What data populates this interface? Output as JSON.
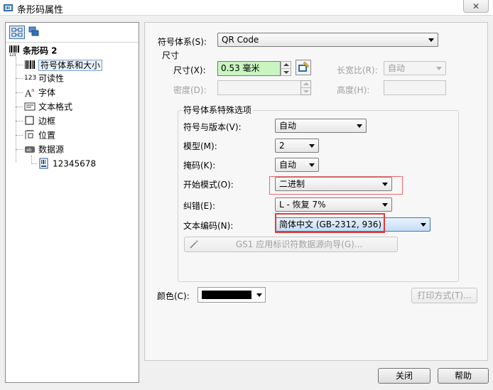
{
  "window": {
    "title": "条形码属性"
  },
  "tree": {
    "root": "条形码 2",
    "items": [
      {
        "label": "符号体系和大小",
        "icon": "barcode-icon"
      },
      {
        "label": "可读性",
        "icon": "digits-icon",
        "icon_text": "123"
      },
      {
        "label": "字体",
        "icon": "font-icon"
      },
      {
        "label": "文本格式",
        "icon": "text-format-icon"
      },
      {
        "label": "边框",
        "icon": "border-icon"
      },
      {
        "label": "位置",
        "icon": "position-icon"
      },
      {
        "label": "数据源",
        "icon": "datasource-icon"
      }
    ],
    "sub_item": "12345678"
  },
  "panel": {
    "symbology_label": "符号体系(S):",
    "symbology_value": "QR Code",
    "size_group": "尺寸",
    "size_label": "尺寸(X):",
    "size_value": "0.53 毫米",
    "ratio_label": "长宽比(R):",
    "ratio_value": "自动",
    "density_label": "密度(D):",
    "density_value": "",
    "height_label": "高度(H):",
    "height_value": "",
    "special_group": "符号体系特殊选项",
    "rows": [
      {
        "label": "符号与版本(V):",
        "value": "自动"
      },
      {
        "label": "模型(M):",
        "value": "2"
      },
      {
        "label": "掩码(K):",
        "value": "自动"
      },
      {
        "label": "开始模式(O):",
        "value": "二进制"
      },
      {
        "label": "纠错(E):",
        "value": "L - 恢复 7%"
      },
      {
        "label": "文本编码(N):",
        "value": "简体中文 (GB-2312, 936)"
      }
    ],
    "gs1_button": "GS1 应用标识符数据源向导(G)...",
    "color_label": "颜色(C):",
    "print_method_button": "打印方式(T)..."
  },
  "footer": {
    "close_button": "关闭",
    "help_button": "帮助"
  },
  "colors": {
    "highlight_red": "#e03c3c",
    "size_field_green": "#c8f5c0",
    "barcode_color": "#000000"
  }
}
